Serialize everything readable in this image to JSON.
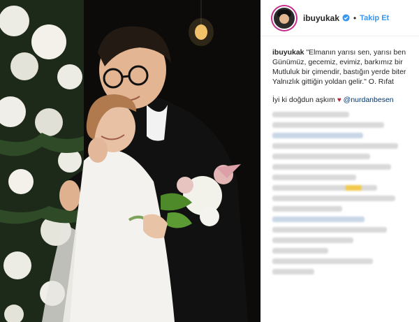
{
  "post": {
    "username": "ibuyukak",
    "follow_label": "Takip Et",
    "caption_lines": [
      "\"Elmanın yarısı sen, yarısı ben",
      "Günümüz, gecemiz, evimiz, barkımız bir",
      "Mutluluk bir çimendir, bastığın yerde biter",
      "Yalnızlık gittiğin yoldan gelir.\" O. Rıfat"
    ],
    "second_text": "İyi ki doğdun aşkım",
    "mention": "@nurdanbesen"
  },
  "colors": {
    "accent": "#3897f0",
    "heart": "#b5243a",
    "mention": "#003569"
  },
  "icons": {
    "verified": "verified-badge-icon",
    "heart": "heart-icon"
  }
}
